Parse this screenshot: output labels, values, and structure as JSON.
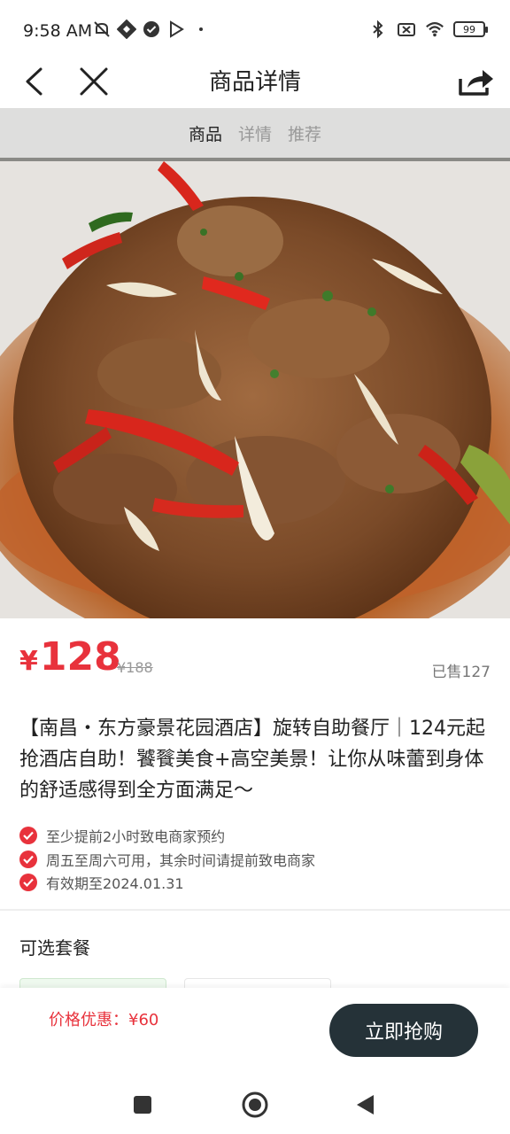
{
  "status_bar": {
    "time": "9:58 AM",
    "battery": "99",
    "icons_left": [
      "mute-icon",
      "app-icon",
      "check-badge-icon",
      "play-store-icon",
      "dot-icon"
    ],
    "icons_right": [
      "bluetooth-icon",
      "sim-off-icon",
      "wifi-icon",
      "battery-icon"
    ]
  },
  "nav": {
    "title": "商品详情",
    "icons": [
      "back-icon",
      "close-icon",
      "share-icon"
    ]
  },
  "section_tabs": [
    {
      "label": "商品",
      "active": true
    },
    {
      "label": "详情",
      "active": false
    },
    {
      "label": "推荐",
      "active": false
    }
  ],
  "product": {
    "currency": "¥",
    "price": "128",
    "original_price": "¥188",
    "sold": "已售127",
    "title": "【南昌・东方豪景花园酒店】旋转自助餐厅｜124元起抢酒店自助！饕餮美食+高空美景！让你从味蕾到身体的舒适感得到全方面满足～",
    "notes": [
      "至少提前2小时致电商家预约",
      "周五至周六可用，其余时间请提前致电商家",
      "有效期至2024.01.31"
    ]
  },
  "packages": {
    "title": "可选套餐"
  },
  "action_bar": {
    "discount": "价格优惠：¥60",
    "buy_label": "立即抢购"
  },
  "colors": {
    "accent": "#e8323c",
    "button": "#253238"
  }
}
